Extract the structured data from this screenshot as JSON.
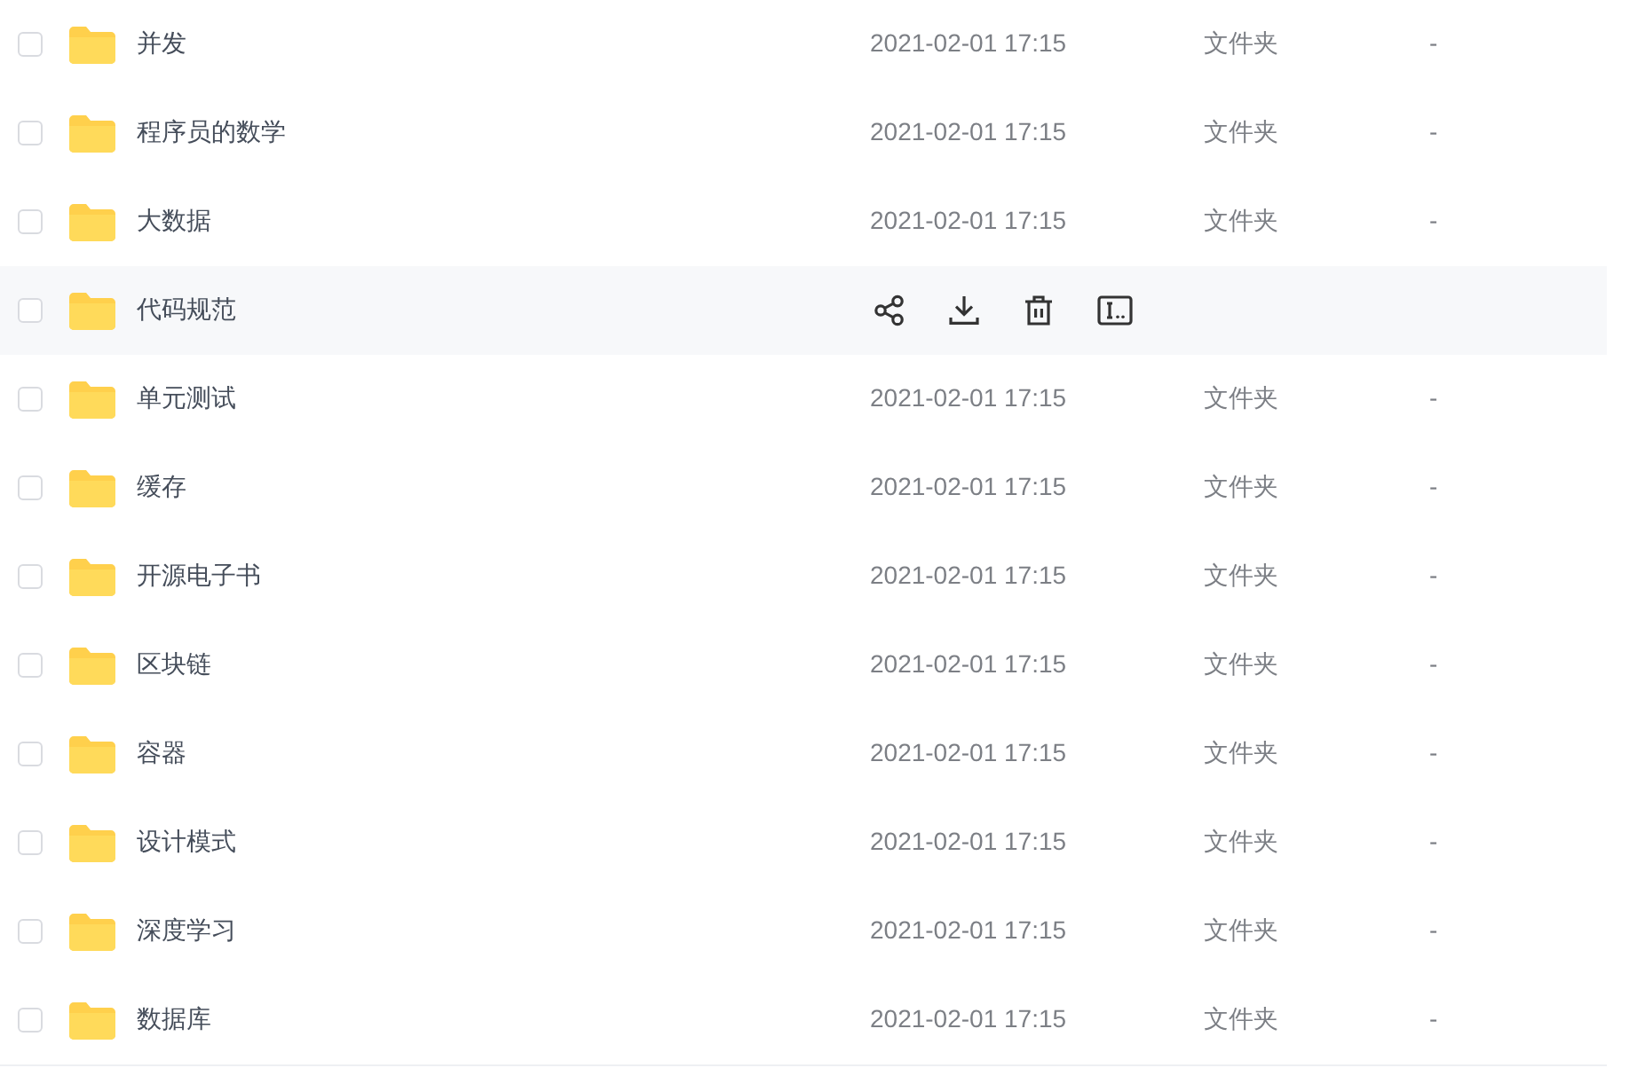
{
  "rows": [
    {
      "name": "并发",
      "modified": "2021-02-01 17:15",
      "type": "文件夹",
      "size": "-",
      "checked": false,
      "hovered": false
    },
    {
      "name": "程序员的数学",
      "modified": "2021-02-01 17:15",
      "type": "文件夹",
      "size": "-",
      "checked": false,
      "hovered": false
    },
    {
      "name": "大数据",
      "modified": "2021-02-01 17:15",
      "type": "文件夹",
      "size": "-",
      "checked": false,
      "hovered": false
    },
    {
      "name": "代码规范",
      "checked": false,
      "hovered": true
    },
    {
      "name": "单元测试",
      "modified": "2021-02-01 17:15",
      "type": "文件夹",
      "size": "-",
      "checked": false,
      "hovered": false
    },
    {
      "name": "缓存",
      "modified": "2021-02-01 17:15",
      "type": "文件夹",
      "size": "-",
      "checked": false,
      "hovered": false
    },
    {
      "name": "开源电子书",
      "modified": "2021-02-01 17:15",
      "type": "文件夹",
      "size": "-",
      "checked": false,
      "hovered": false
    },
    {
      "name": "区块链",
      "modified": "2021-02-01 17:15",
      "type": "文件夹",
      "size": "-",
      "checked": false,
      "hovered": false
    },
    {
      "name": "容器",
      "modified": "2021-02-01 17:15",
      "type": "文件夹",
      "size": "-",
      "checked": false,
      "hovered": false
    },
    {
      "name": "设计模式",
      "modified": "2021-02-01 17:15",
      "type": "文件夹",
      "size": "-",
      "checked": false,
      "hovered": false
    },
    {
      "name": "深度学习",
      "modified": "2021-02-01 17:15",
      "type": "文件夹",
      "size": "-",
      "checked": false,
      "hovered": false
    },
    {
      "name": "数据库",
      "modified": "2021-02-01 17:15",
      "type": "文件夹",
      "size": "-",
      "checked": false,
      "hovered": false
    }
  ]
}
